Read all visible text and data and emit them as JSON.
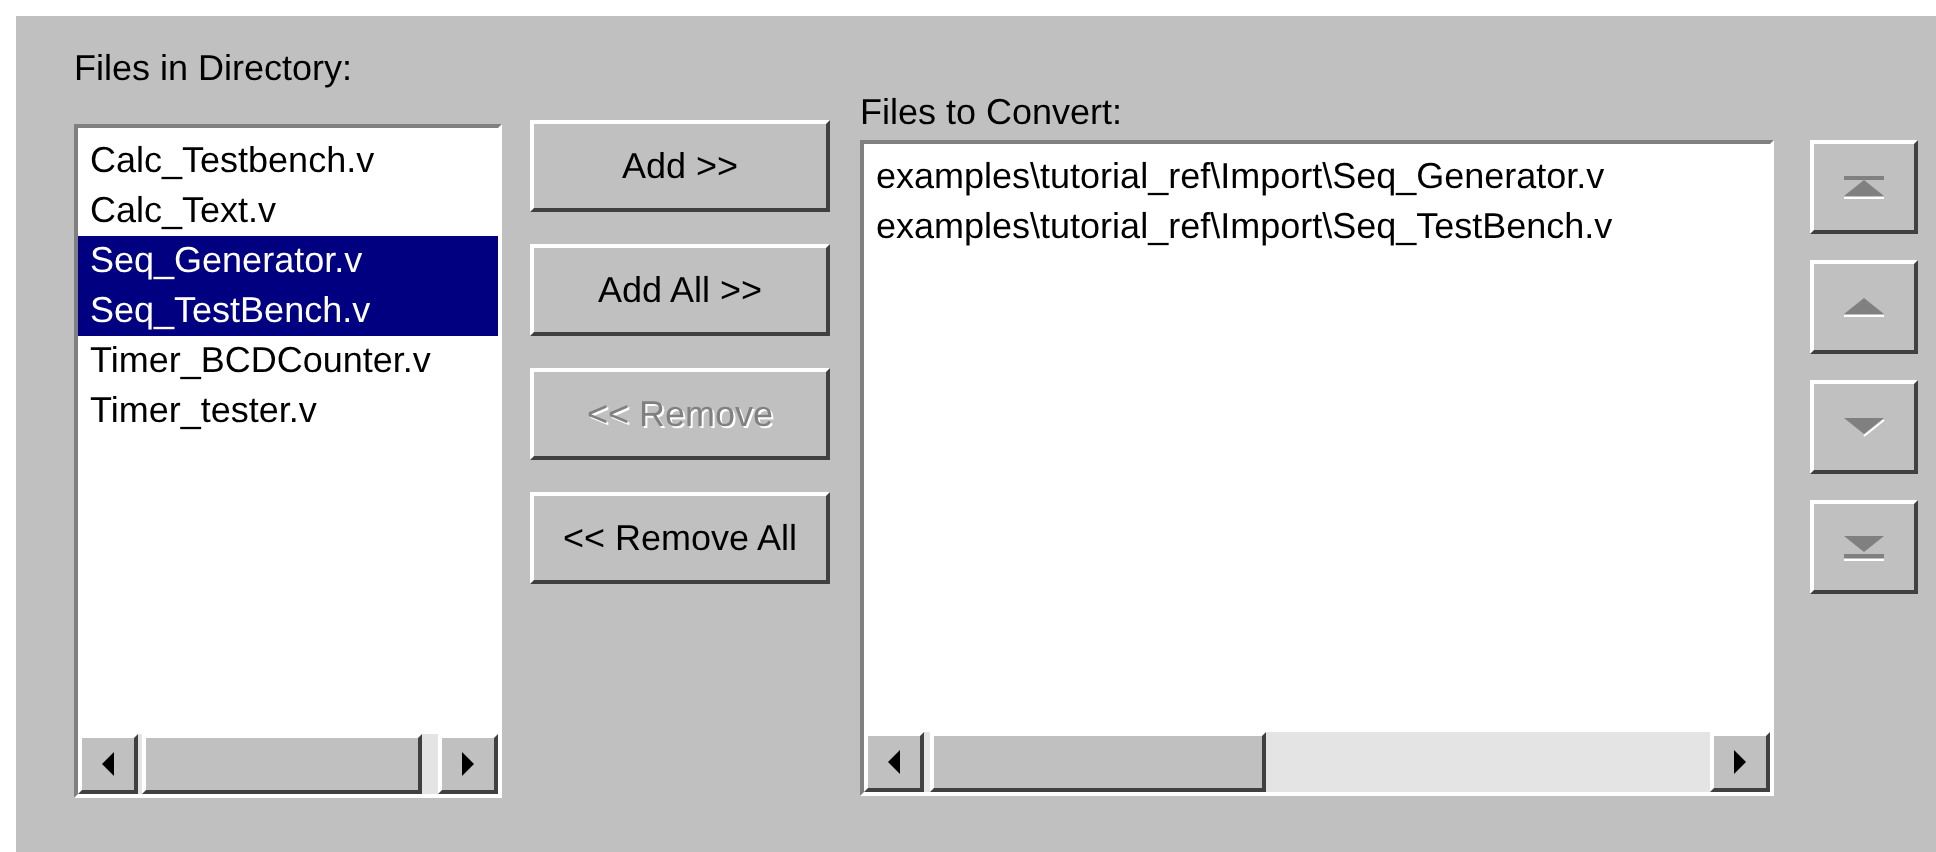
{
  "source_list": {
    "label": "Files in Directory:",
    "items": [
      {
        "text": "Calc_Testbench.v",
        "selected": false
      },
      {
        "text": "Calc_Text.v",
        "selected": false
      },
      {
        "text": "Seq_Generator.v",
        "selected": true
      },
      {
        "text": "Seq_TestBench.v",
        "selected": true
      },
      {
        "text": "Timer_BCDCounter.v",
        "selected": false
      },
      {
        "text": "Timer_tester.v",
        "selected": false
      }
    ]
  },
  "transfer_buttons": [
    {
      "label": "Add >>",
      "disabled": false
    },
    {
      "label": "Add All >>",
      "disabled": false
    },
    {
      "label": "<< Remove",
      "disabled": true
    },
    {
      "label": "<< Remove All",
      "disabled": false
    }
  ],
  "target_list": {
    "label": "Files to Convert:",
    "items": [
      {
        "text": "examples\\tutorial_ref\\Import\\Seq_Generator.v",
        "selected": false
      },
      {
        "text": "examples\\tutorial_ref\\Import\\Seq_TestBench.v",
        "selected": false
      }
    ]
  },
  "order_buttons": [
    {
      "kind": "top",
      "disabled": true
    },
    {
      "kind": "up",
      "disabled": true
    },
    {
      "kind": "down",
      "disabled": true
    },
    {
      "kind": "bottom",
      "disabled": true
    }
  ]
}
